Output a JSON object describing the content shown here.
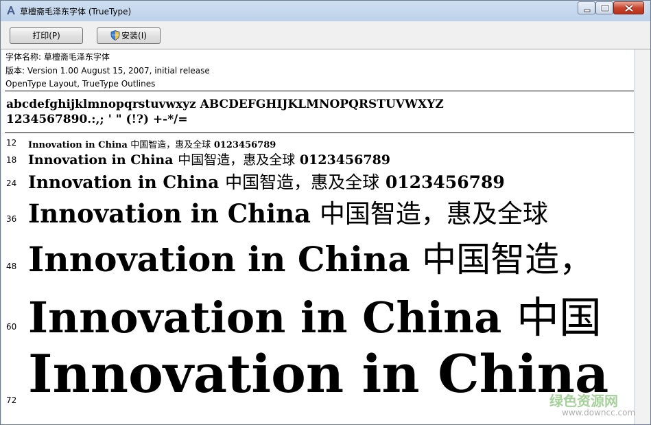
{
  "window": {
    "title": "草檀斋毛泽东字体 (TrueType)"
  },
  "toolbar": {
    "print_label": "打印(P)",
    "install_label": "安装(I)"
  },
  "font_info": {
    "name_line": "字体名称: 草檀斋毛泽东字体",
    "version_line": "版本: Version 1.00 August 15, 2007, initial release",
    "type_line": "OpenType Layout, TrueType Outlines"
  },
  "charset": {
    "line1": "abcdefghijklmnopqrstuvwxyz ABCDEFGHIJKLMNOPQRSTUVWXYZ",
    "line2": "1234567890.:,; ' \" (!?) +-*/="
  },
  "samples": [
    {
      "size": "12",
      "latin": "Innovation in China",
      "cn": "中国智造，惠及全球",
      "digits": "0123456789"
    },
    {
      "size": "18",
      "latin": "Innovation in China",
      "cn": "中国智造，惠及全球",
      "digits": "0123456789"
    },
    {
      "size": "24",
      "latin": "Innovation in China",
      "cn": "中国智造，惠及全球",
      "digits": "0123456789"
    },
    {
      "size": "36",
      "latin": "Innovation in China",
      "cn": "中国智造，惠及全球",
      "digits": ""
    },
    {
      "size": "48",
      "latin": "Innovation in China",
      "cn": "中国智造，",
      "digits": ""
    },
    {
      "size": "60",
      "latin": "Innovation in China",
      "cn": "中国",
      "digits": ""
    },
    {
      "size": "72",
      "latin": "Innovation in China",
      "cn": "",
      "digits": ""
    }
  ],
  "watermark": {
    "line1": "绿色资源网",
    "line2": "www.downcc.com"
  }
}
